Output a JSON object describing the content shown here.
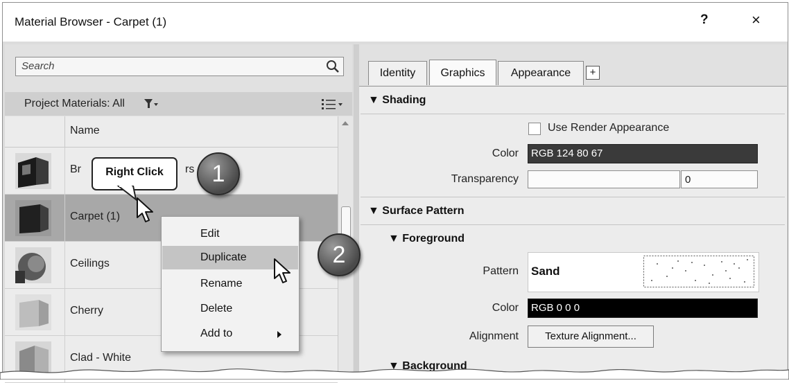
{
  "window": {
    "title": "Material Browser - Carpet (1)",
    "help": "?",
    "close": "×"
  },
  "search": {
    "placeholder": "Search"
  },
  "filter": {
    "label": "Project Materials: All"
  },
  "list": {
    "header": "Name",
    "rows": [
      {
        "name": "Br",
        "suffix": "rs"
      },
      {
        "name": "Carpet (1)"
      },
      {
        "name": "Ceilings"
      },
      {
        "name": "Cherry"
      },
      {
        "name": "Clad - White"
      }
    ]
  },
  "tabs": {
    "identity": "Identity",
    "graphics": "Graphics",
    "appearance": "Appearance",
    "add": "+"
  },
  "shading": {
    "title": "Shading",
    "use_render_appearance": "Use Render Appearance",
    "color_label": "Color",
    "color_value": "RGB 124 80 67",
    "transparency_label": "Transparency",
    "transparency_value": "0"
  },
  "surface_pattern": {
    "title": "Surface Pattern",
    "foreground": "Foreground",
    "pattern_label": "Pattern",
    "pattern_value": "Sand",
    "color_label": "Color",
    "color_value": "RGB 0 0 0",
    "alignment_label": "Alignment",
    "alignment_button": "Texture Alignment...",
    "background": "Background"
  },
  "context_menu": {
    "items": [
      "Edit",
      "Duplicate",
      "Rename",
      "Delete",
      "Add to"
    ]
  },
  "callouts": {
    "right_click": "Right Click",
    "step1": "1",
    "step2": "2"
  },
  "colors": {
    "shading_color": "#3a3a3a",
    "selected_row": "#a8a8a8",
    "menu_hover": "#c4c4c4"
  }
}
